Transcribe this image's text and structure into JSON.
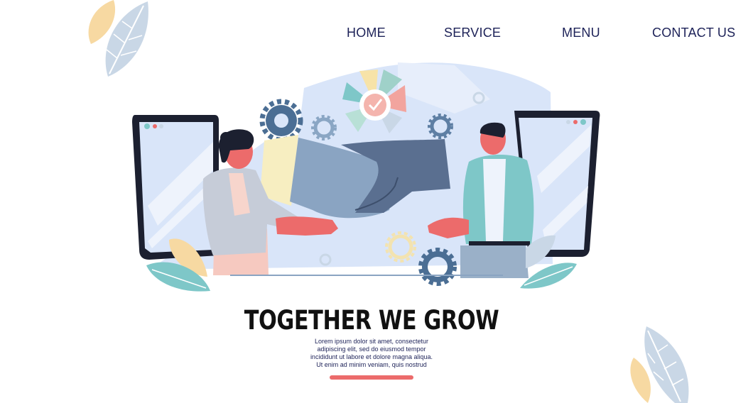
{
  "nav": {
    "items": [
      {
        "label": "HOME"
      },
      {
        "label": "SERVICE"
      },
      {
        "label": "MENU"
      },
      {
        "label": "CONTACT US"
      }
    ]
  },
  "hero": {
    "headline": "TOGETHER WE GROW",
    "body_lines": [
      "Lorem ipsum dolor sit amet, consectetur",
      "adipiscing elit, sed do eiusmod tempor",
      "incididunt ut labore et dolore magna aliqua.",
      "Ut enim ad minim veniam, quis nostrud"
    ]
  },
  "colors": {
    "nav_text": "#1d2258",
    "accent": "#ec6b6b",
    "backdrop": "#d9e5f9",
    "teal": "#7ec7c8",
    "leaf_blue": "#c9d7e6",
    "leaf_yellow": "#f7d9a2",
    "gear": "#4b6e94"
  },
  "icons": [
    "gear-icon",
    "check-badge-icon",
    "leaf-icon",
    "phone-screen-icon",
    "handshake-icon"
  ]
}
